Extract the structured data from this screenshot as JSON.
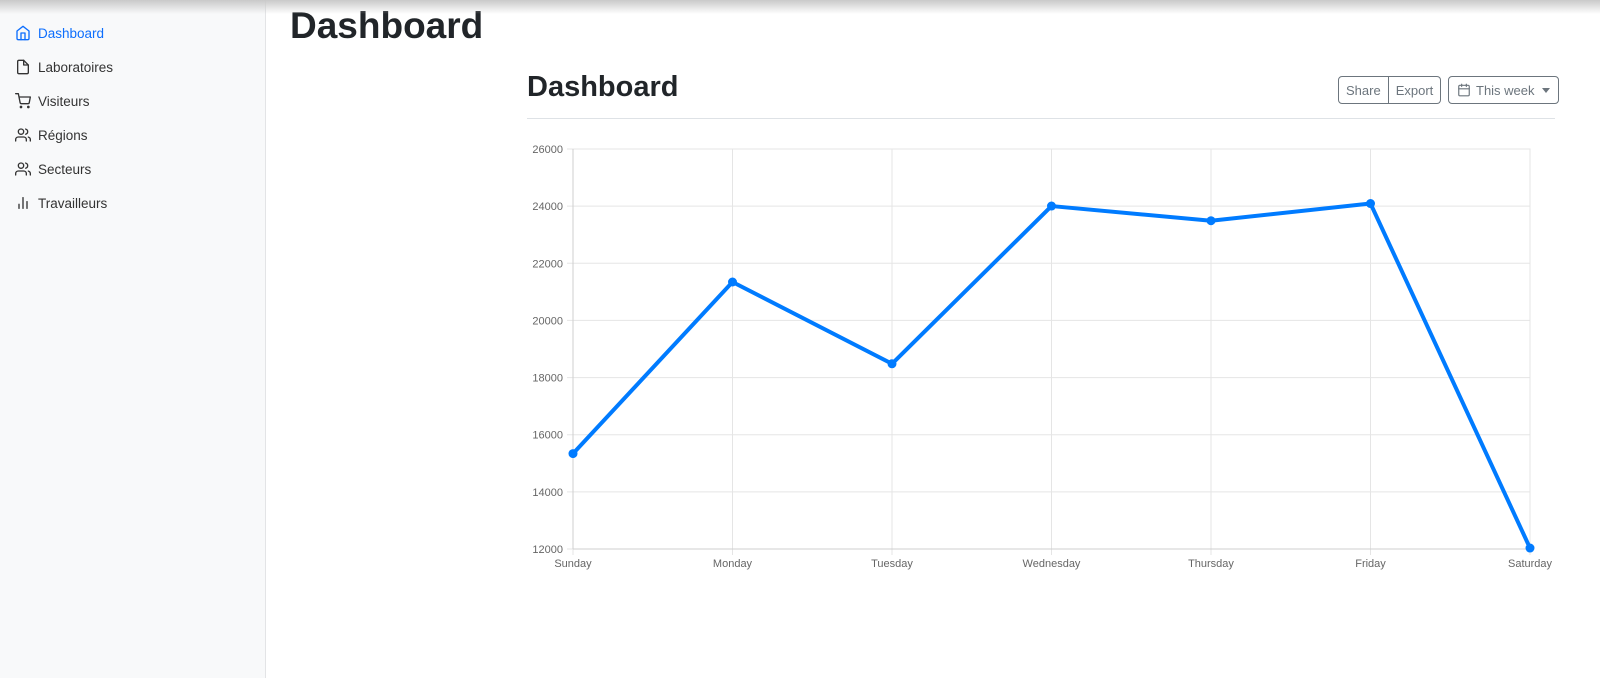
{
  "sidebar": {
    "items": [
      {
        "label": "Dashboard",
        "icon": "home-icon",
        "active": true
      },
      {
        "label": "Laboratoires",
        "icon": "file-icon",
        "active": false
      },
      {
        "label": "Visiteurs",
        "icon": "shopping-cart-icon",
        "active": false
      },
      {
        "label": "Régions",
        "icon": "users-icon",
        "active": false
      },
      {
        "label": "Secteurs",
        "icon": "users-icon",
        "active": false
      },
      {
        "label": "Travailleurs",
        "icon": "bar-chart-icon",
        "active": false
      }
    ]
  },
  "header": {
    "title": "Dashboard"
  },
  "main": {
    "title": "Dashboard",
    "toolbar": {
      "share_label": "Share",
      "export_label": "Export",
      "range_label": "This week"
    }
  },
  "colors": {
    "accent": "#0d6efd",
    "line": "#007bff",
    "grid": "#e5e5e5"
  },
  "chart_data": {
    "type": "line",
    "categories": [
      "Sunday",
      "Monday",
      "Tuesday",
      "Wednesday",
      "Thursday",
      "Friday",
      "Saturday"
    ],
    "series": [
      {
        "values": [
          15339,
          21345,
          18483,
          24003,
          23489,
          24092,
          12034
        ]
      }
    ],
    "ylim": [
      12000,
      26000
    ],
    "yticks": [
      "12000",
      "14000",
      "16000",
      "18000",
      "20000",
      "22000",
      "24000",
      "26000"
    ],
    "grid": true,
    "legend": "none"
  }
}
